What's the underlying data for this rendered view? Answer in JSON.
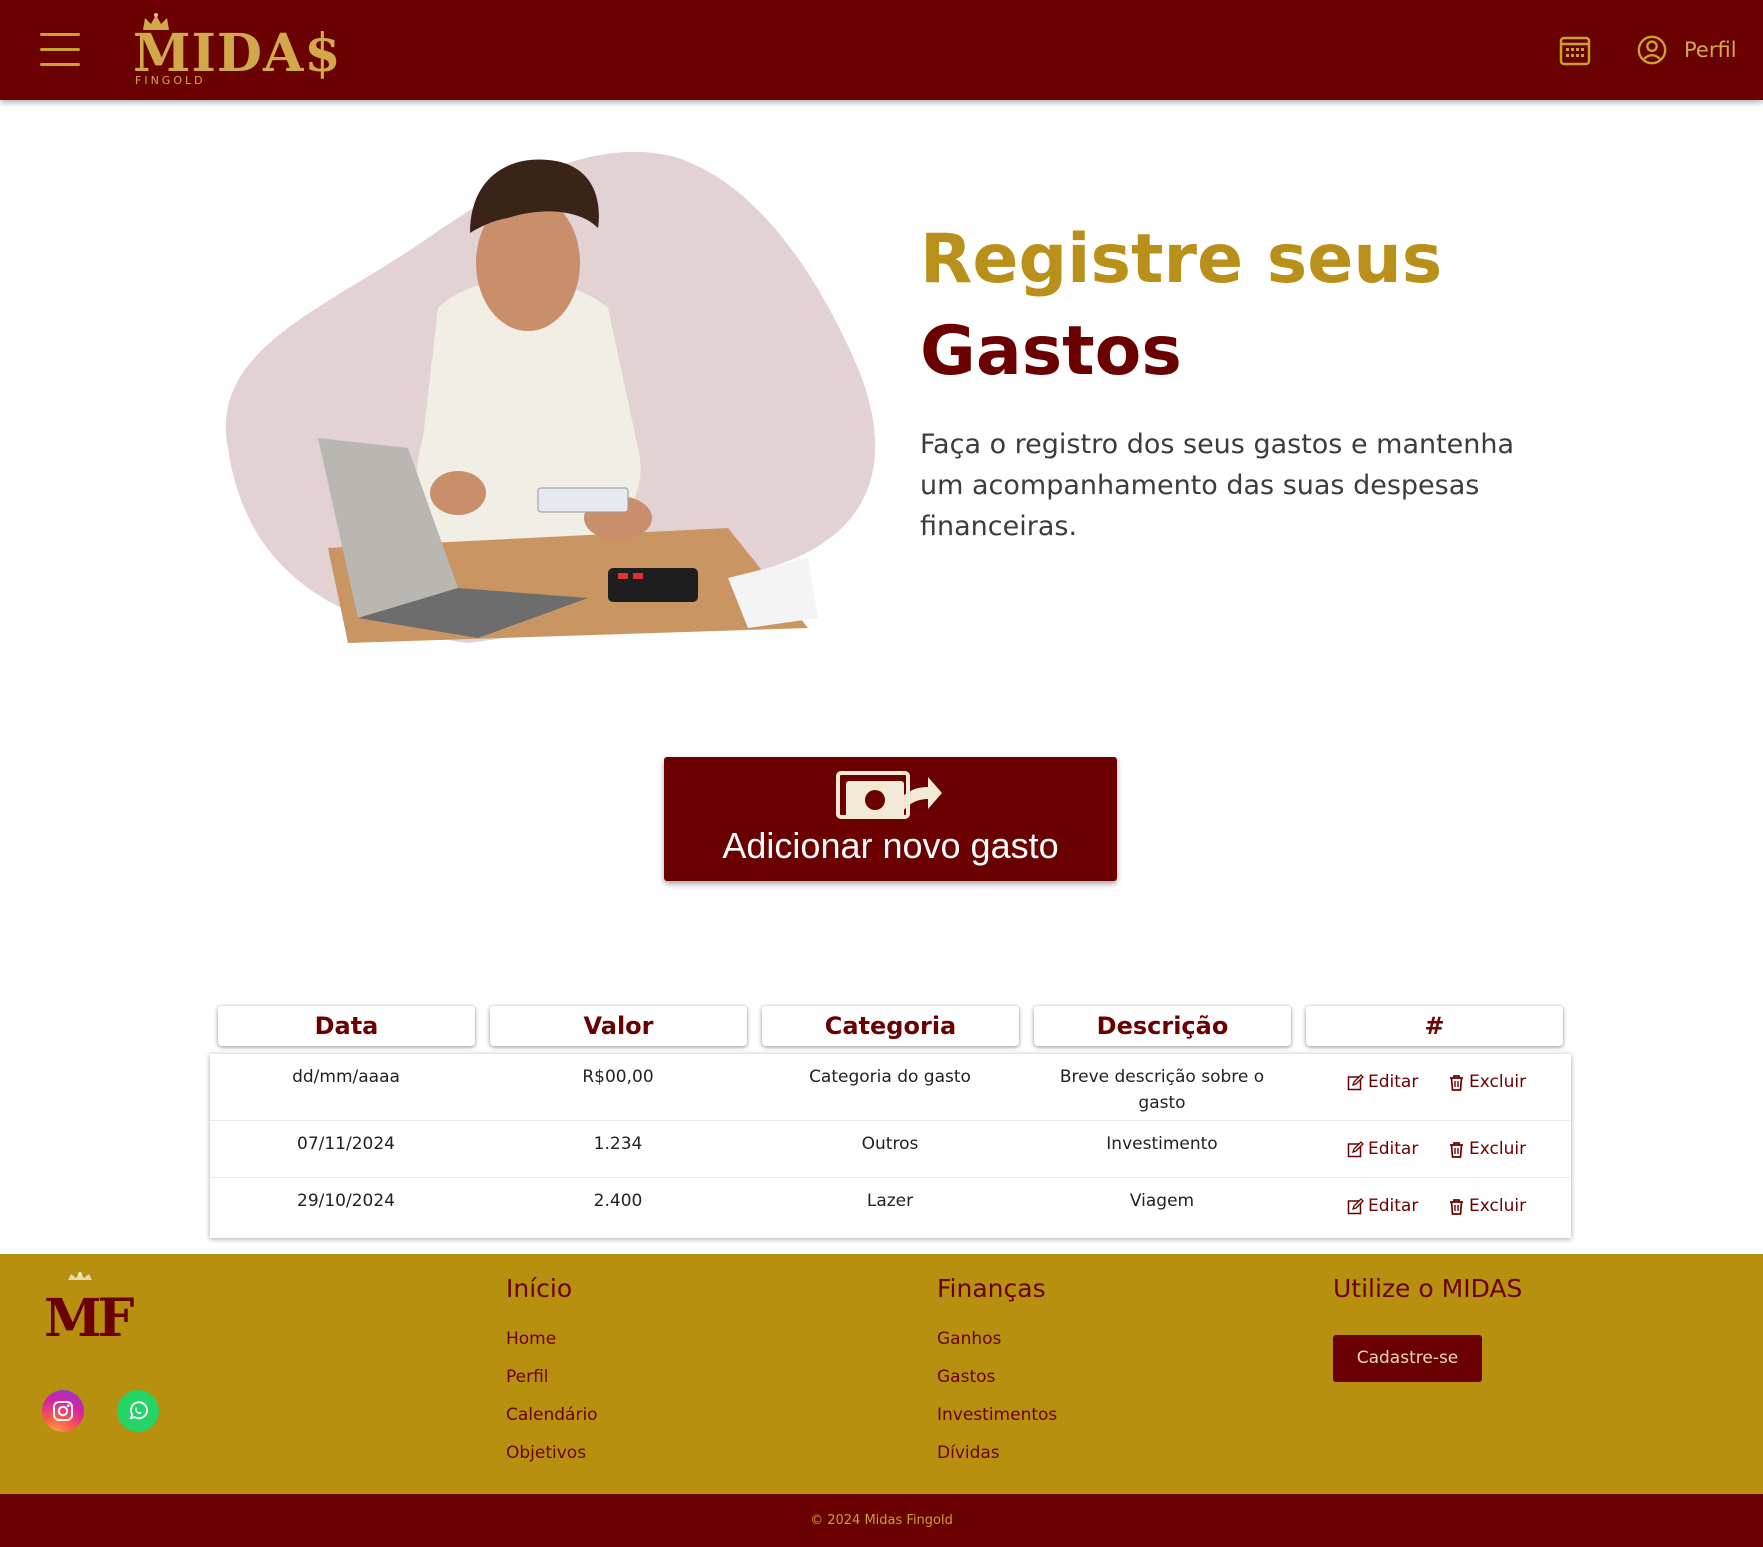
{
  "brand": {
    "name": "MIDA$",
    "sub": "FINGOLD"
  },
  "header": {
    "profile_label": "Perfil"
  },
  "hero": {
    "title_line1": "Registre seus",
    "title_line2": "Gastos",
    "text": "Faça o registro dos seus gastos e mantenha um acompanhamento das suas despesas financeiras."
  },
  "add_button": {
    "label": "Adicionar novo gasto"
  },
  "table": {
    "headers": [
      "Data",
      "Valor",
      "Categoria",
      "Descrição",
      "#"
    ],
    "rows": [
      {
        "data": "dd/mm/aaaa",
        "valor": "R$00,00",
        "categoria": "Categoria do gasto",
        "descricao": "Breve descrição sobre o gasto"
      },
      {
        "data": "07/11/2024",
        "valor": "1.234",
        "categoria": "Outros",
        "descricao": "Investimento"
      },
      {
        "data": "29/10/2024",
        "valor": "2.400",
        "categoria": "Lazer",
        "descricao": "Viagem"
      }
    ],
    "edit_label": "Editar",
    "delete_label": "Excluir"
  },
  "footer": {
    "logo_text": "MF",
    "col_inicio": {
      "title": "Início",
      "links": [
        "Home",
        "Perfil",
        "Calendário",
        "Objetivos"
      ]
    },
    "col_financas": {
      "title": "Finanças",
      "links": [
        "Ganhos",
        "Gastos",
        "Investimentos",
        "Dívidas"
      ]
    },
    "col_utilize": {
      "title": "Utilize o MIDAS",
      "button": "Cadastre-se"
    },
    "copyright": "© 2024 Midas Fingold"
  },
  "colors": {
    "primary": "#6b0000",
    "gold": "#b8900f",
    "gold_text": "#d2a94a",
    "white": "#ffffff"
  }
}
